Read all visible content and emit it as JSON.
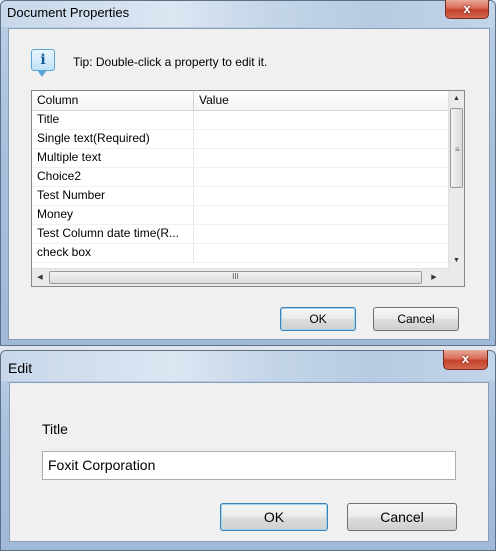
{
  "doc_props": {
    "title": "Document Properties",
    "close_glyph": "x",
    "tip_icon_glyph": "i",
    "tip_text": "Tip: Double-click a property to edit it.",
    "columns": {
      "column": "Column",
      "value": "Value"
    },
    "rows": [
      {
        "name": "Title",
        "value": ""
      },
      {
        "name": "Single text(Required)",
        "value": ""
      },
      {
        "name": "Multiple text",
        "value": ""
      },
      {
        "name": "Choice2",
        "value": ""
      },
      {
        "name": "Test Number",
        "value": ""
      },
      {
        "name": "Money",
        "value": ""
      },
      {
        "name": "Test Column date time(R...",
        "value": ""
      },
      {
        "name": "check box",
        "value": ""
      }
    ],
    "scroll_grip": "≡",
    "hscroll_grip": "III",
    "ok_label": "OK",
    "cancel_label": "Cancel"
  },
  "edit": {
    "title": "Edit",
    "close_glyph": "x",
    "field_label": "Title",
    "field_value": "Foxit Corporation",
    "ok_label": "OK",
    "cancel_label": "Cancel"
  }
}
